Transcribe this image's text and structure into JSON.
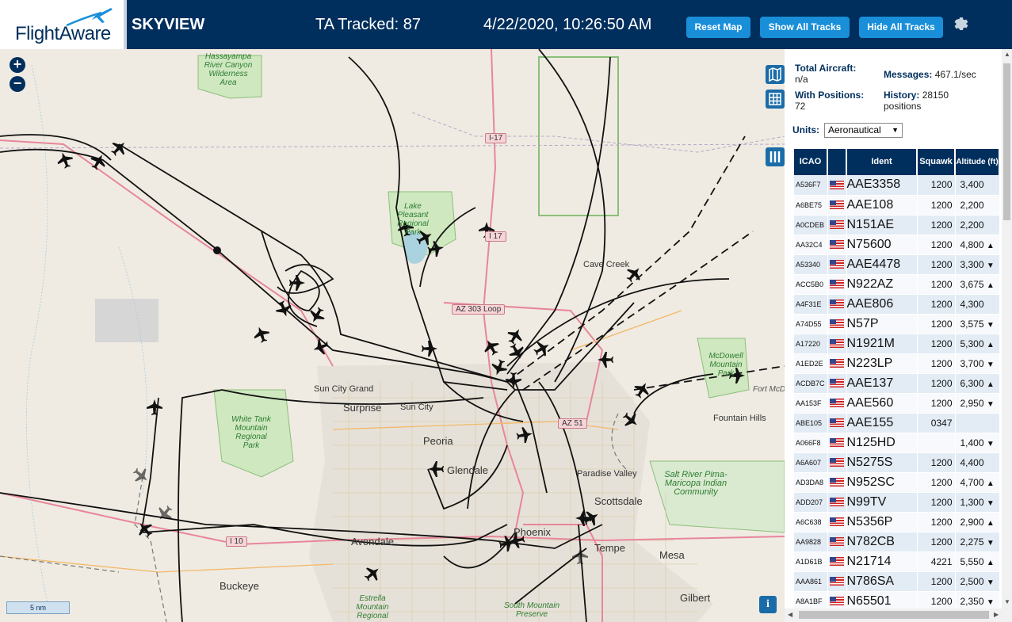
{
  "header": {
    "logo_text": "FlightAware",
    "app_name": "SKYVIEW",
    "tracked_label": "TA Tracked: 87",
    "datetime": "4/22/2020, 10:26:50 AM",
    "buttons": [
      "Reset Map",
      "Show All Tracks",
      "Hide All Tracks"
    ],
    "settings_icon": "gear-icon"
  },
  "map": {
    "zoom_in": "+",
    "zoom_out": "−",
    "scale": "5 nm",
    "info": "i",
    "road_shields": [
      "I-17",
      "I 17",
      "AZ 303 Loop",
      "AZ 51",
      "I 10"
    ],
    "places": [
      "Cave Creek",
      "Sun City Grand",
      "Surprise",
      "Sun City",
      "Peoria",
      "Glendale",
      "Paradise Valley",
      "Scottsdale",
      "Phoenix",
      "Tempe",
      "Mesa",
      "Avondale",
      "Buckeye",
      "Gilbert",
      "Fountain Hills",
      "Fort McDowell Yavapai Nation"
    ],
    "parks": [
      "Hassayampa River Canyon Wilderness Area",
      "Lake Pleasant Regional Park",
      "White Tank Mountain Regional Park",
      "McDowell Mountain Park",
      "Salt River Pima-Maricopa Indian Community",
      "Estrella Mountain Regional",
      "South Mountain Preserve"
    ]
  },
  "stats": {
    "total_aircraft_label": "Total Aircraft:",
    "total_aircraft_value": "n/a",
    "with_positions_label": "With Positions:",
    "with_positions_value": "72",
    "messages_label": "Messages:",
    "messages_value": "467.1/sec",
    "history_label": "History:",
    "history_value": "28150",
    "history_unit": "positions"
  },
  "units": {
    "label": "Units:",
    "selected": "Aeronautical"
  },
  "table": {
    "headers": [
      "ICAO",
      "",
      "Ident",
      "Squawk",
      "Altitude (ft)"
    ],
    "rows": [
      {
        "icao": "A536F7",
        "ident": "AAE3358",
        "squawk": "1200",
        "alt": "3,400",
        "trend": ""
      },
      {
        "icao": "A6BE75",
        "ident": "AAE108",
        "squawk": "1200",
        "alt": "2,200",
        "trend": ""
      },
      {
        "icao": "A0CDEB",
        "ident": "N151AE",
        "squawk": "1200",
        "alt": "2,200",
        "trend": ""
      },
      {
        "icao": "AA32C4",
        "ident": "N75600",
        "squawk": "1200",
        "alt": "4,800",
        "trend": "▲"
      },
      {
        "icao": "A53340",
        "ident": "AAE4478",
        "squawk": "1200",
        "alt": "3,300",
        "trend": "▼"
      },
      {
        "icao": "ACC5B0",
        "ident": "N922AZ",
        "squawk": "1200",
        "alt": "3,675",
        "trend": "▲"
      },
      {
        "icao": "A4F31E",
        "ident": "AAE806",
        "squawk": "1200",
        "alt": "4,300",
        "trend": ""
      },
      {
        "icao": "A74D55",
        "ident": "N57P",
        "squawk": "1200",
        "alt": "3,575",
        "trend": "▼"
      },
      {
        "icao": "A17220",
        "ident": "N1921M",
        "squawk": "1200",
        "alt": "5,300",
        "trend": "▲"
      },
      {
        "icao": "A1ED2E",
        "ident": "N223LP",
        "squawk": "1200",
        "alt": "3,700",
        "trend": "▼"
      },
      {
        "icao": "ACDB7C",
        "ident": "AAE137",
        "squawk": "1200",
        "alt": "6,300",
        "trend": "▲"
      },
      {
        "icao": "AA153F",
        "ident": "AAE560",
        "squawk": "1200",
        "alt": "2,950",
        "trend": "▼"
      },
      {
        "icao": "ABE105",
        "ident": "AAE155",
        "squawk": "0347",
        "alt": "",
        "trend": ""
      },
      {
        "icao": "A066F8",
        "ident": "N125HD",
        "squawk": "",
        "alt": "1,400",
        "trend": "▼"
      },
      {
        "icao": "A6A607",
        "ident": "N5275S",
        "squawk": "1200",
        "alt": "4,400",
        "trend": ""
      },
      {
        "icao": "AD3DA8",
        "ident": "N952SC",
        "squawk": "1200",
        "alt": "4,700",
        "trend": "▲"
      },
      {
        "icao": "ADD207",
        "ident": "N99TV",
        "squawk": "1200",
        "alt": "1,300",
        "trend": "▼"
      },
      {
        "icao": "A6C638",
        "ident": "N5356P",
        "squawk": "1200",
        "alt": "2,900",
        "trend": "▲"
      },
      {
        "icao": "AA9828",
        "ident": "N782CB",
        "squawk": "1200",
        "alt": "2,275",
        "trend": "▼"
      },
      {
        "icao": "A1D61B",
        "ident": "N21714",
        "squawk": "4221",
        "alt": "5,550",
        "trend": "▲"
      },
      {
        "icao": "AAA861",
        "ident": "N786SA",
        "squawk": "1200",
        "alt": "2,500",
        "trend": "▼"
      },
      {
        "icao": "A8A1BF",
        "ident": "N65501",
        "squawk": "1200",
        "alt": "2,350",
        "trend": "▼"
      }
    ]
  },
  "colors": {
    "header_bg": "#002f5d",
    "button": "#1a8fd9",
    "table_header": "#002f5d"
  }
}
